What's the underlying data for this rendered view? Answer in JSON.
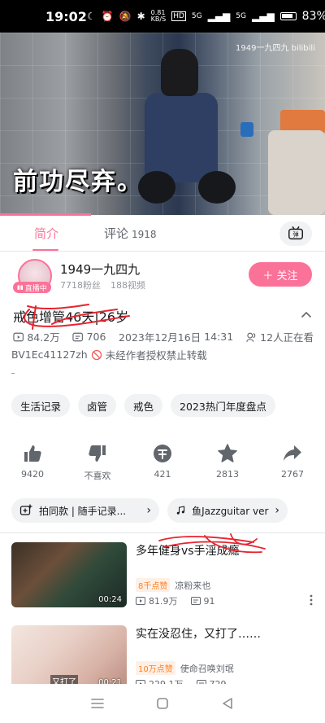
{
  "status_bar": {
    "time": "19:02",
    "network_speed": "0.81\nKB/S",
    "signal_1": "5G",
    "signal_2": "5G",
    "battery": "83%"
  },
  "video": {
    "caption": "前功尽弃。",
    "watermark": "1949一九四九 bilibili",
    "progress_fraction": 0.28
  },
  "tabs": {
    "intro": "简介",
    "comments": "评论",
    "comments_count": "1918"
  },
  "uploader": {
    "name": "1949一九四九",
    "followers": "7718粉丝",
    "videos": "188视频",
    "live_badge": "直播中",
    "follow_label": "＋ 关注"
  },
  "video_info": {
    "title": "戒色增管46天|26岁",
    "views": "84.2万",
    "danmaku": "706",
    "date": "2023年12月16日",
    "time": "14:31",
    "watching": "12人正在看",
    "bvid": "BV1Ec41127zh",
    "copyright": "未经作者授权禁止转载"
  },
  "tags": [
    "生活记录",
    "卤管",
    "戒色",
    "2023热门年度盘点"
  ],
  "actions": [
    {
      "icon": "like-icon",
      "label": "9420"
    },
    {
      "icon": "dislike-icon",
      "label": "不喜欢"
    },
    {
      "icon": "coin-icon",
      "label": "421"
    },
    {
      "icon": "favorite-icon",
      "label": "2813"
    },
    {
      "icon": "share-icon",
      "label": "2767"
    }
  ],
  "extras": {
    "chip_1": "拍同款 | 随手记录...",
    "chip_2": "鱼Jazzguitar ver"
  },
  "recommendations": [
    {
      "title": "多年健身vs手淫成瘾",
      "badge": "8千点赞",
      "author": "凉粉来也",
      "views": "81.9万",
      "danmaku": "91",
      "duration": "00:24"
    },
    {
      "title": "实在没忍住，又打了……",
      "badge": "10万点赞",
      "author": "使命召唤刘氓",
      "views": "229.1万",
      "danmaku": "729",
      "duration": "00:21",
      "overlay": "又打了"
    }
  ],
  "colors": {
    "accent": "#fb7299",
    "secondary_text": "#61666d",
    "chip_bg": "#f1f2f3",
    "badge_orange": "#ff7f24",
    "scribble_red": "#e8232f"
  }
}
